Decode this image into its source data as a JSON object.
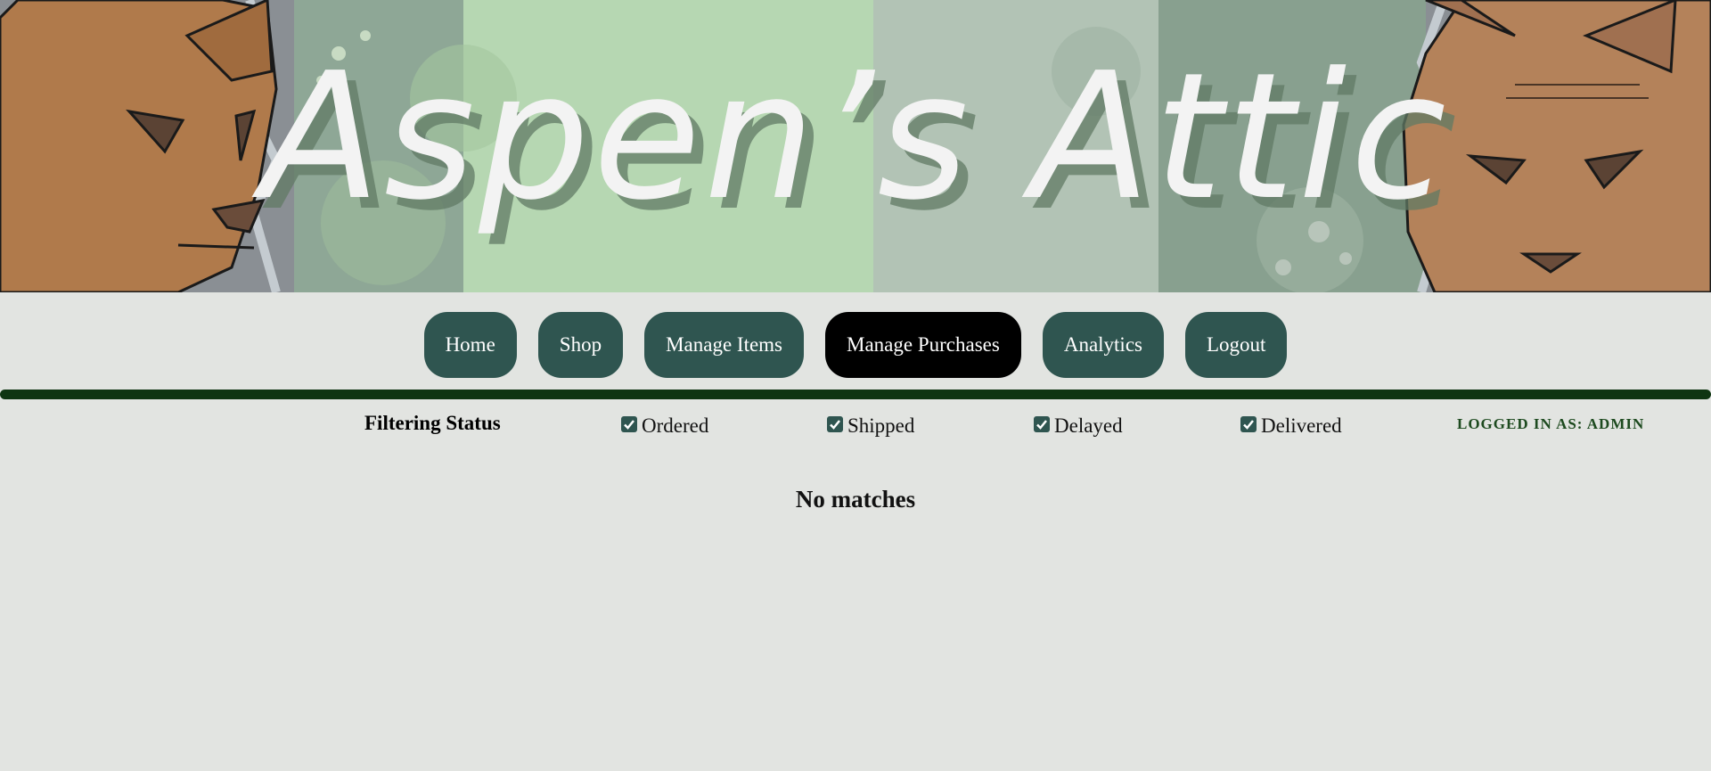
{
  "banner": {
    "title": "Aspen’s Attic",
    "left_figure_icon": "wooden-cat-head-icon",
    "right_figure_icon": "wooden-lynx-head-icon"
  },
  "nav": {
    "items": [
      {
        "label": "Home"
      },
      {
        "label": "Shop"
      },
      {
        "label": "Manage Items"
      },
      {
        "label": "Manage Purchases",
        "active": true
      },
      {
        "label": "Analytics"
      },
      {
        "label": "Logout"
      }
    ]
  },
  "filter": {
    "title": "Filtering Status",
    "options": [
      {
        "label": "Ordered",
        "checked": true
      },
      {
        "label": "Shipped",
        "checked": true
      },
      {
        "label": "Delayed",
        "checked": true
      },
      {
        "label": "Delivered",
        "checked": true
      }
    ]
  },
  "user": {
    "logged_in_label": "LOGGED IN AS: ADMIN"
  },
  "results": {
    "empty_message": "No matches"
  },
  "colors": {
    "page_background": "#e2e4e1",
    "nav_button": "#2f5550",
    "nav_button_active": "#000000",
    "divider": "#0f3512",
    "logged_in_text": "#1d4a1f"
  }
}
